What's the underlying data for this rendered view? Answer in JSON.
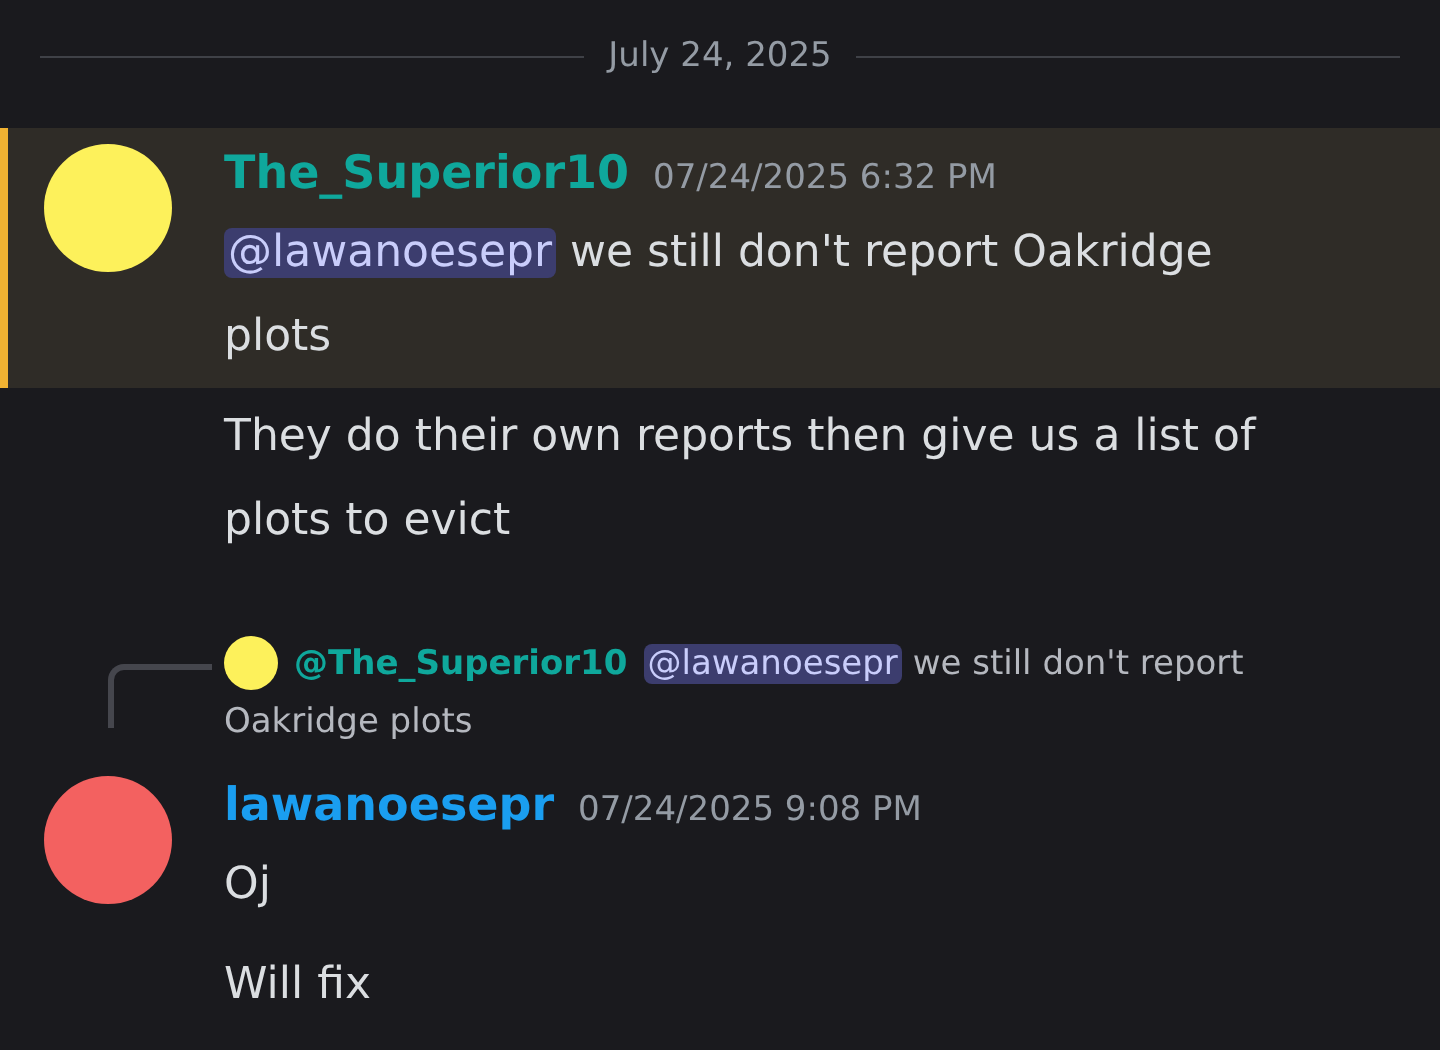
{
  "date_divider": "July 24, 2025",
  "messages": [
    {
      "author": "The_Superior10",
      "timestamp": "07/24/2025 6:32 PM",
      "highlighted": true,
      "paragraphs": [
        [
          {
            "kind": "mention",
            "text": "@lawanoesepr"
          },
          {
            "kind": "text",
            "text": " we still don't report Oakridge plots"
          }
        ],
        [
          {
            "kind": "text",
            "text": "They do their own reports then give us a list of plots to evict"
          }
        ]
      ]
    },
    {
      "author": "lawanoesepr",
      "timestamp": "07/24/2025 9:08 PM",
      "highlighted": false,
      "reply": {
        "author": "@The_Superior10",
        "segments": [
          {
            "kind": "mention",
            "text": "@lawanoesepr"
          },
          {
            "kind": "text",
            "text": " we still don't report Oakridge plots"
          }
        ]
      },
      "paragraphs": [
        [
          {
            "kind": "text",
            "text": "Oj"
          }
        ],
        [
          {
            "kind": "text",
            "text": "Will fix"
          }
        ]
      ]
    }
  ]
}
